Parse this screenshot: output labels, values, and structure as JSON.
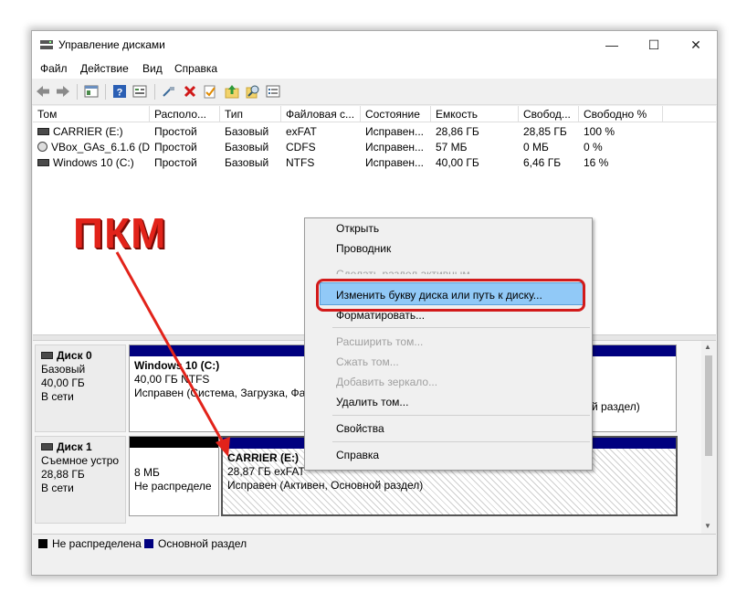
{
  "window": {
    "title": "Управление дисками",
    "controls": {
      "minimize": "—",
      "maximize": "☐",
      "close": "✕"
    }
  },
  "menu": [
    "Файл",
    "Действие",
    "Вид",
    "Справка"
  ],
  "toolbar_icons": [
    "back-arrow-icon",
    "forward-arrow-icon",
    "properties-icon",
    "help-icon",
    "view-icon",
    "connect-icon",
    "delete-icon",
    "check-icon",
    "folder-up-icon",
    "search-icon",
    "settings-icon"
  ],
  "volumes": {
    "columns": [
      "Том",
      "Располо...",
      "Тип",
      "Файловая с...",
      "Состояние",
      "Емкость",
      "Свобод...",
      "Свободно %"
    ],
    "rows": [
      {
        "name": "CARRIER (E:)",
        "layout": "Простой",
        "type": "Базовый",
        "fs": "exFAT",
        "status": "Исправен...",
        "capacity": "28,86 ГБ",
        "free": "28,85 ГБ",
        "free_pct": "100 %",
        "icon": "drive-icon"
      },
      {
        "name": "VBox_GAs_6.1.6 (D:)",
        "layout": "Простой",
        "type": "Базовый",
        "fs": "CDFS",
        "status": "Исправен...",
        "capacity": "57 МБ",
        "free": "0 МБ",
        "free_pct": "0 %",
        "icon": "cd-icon"
      },
      {
        "name": "Windows 10 (C:)",
        "layout": "Простой",
        "type": "Базовый",
        "fs": "NTFS",
        "status": "Исправен...",
        "capacity": "40,00 ГБ",
        "free": "6,46 ГБ",
        "free_pct": "16 %",
        "icon": "drive-icon"
      }
    ]
  },
  "disks": [
    {
      "name": "Диск 0",
      "kind": "Базовый",
      "size": "40,00 ГБ",
      "state": "В сети",
      "partitions": [
        {
          "title": "Windows 10  (C:)",
          "line1": "40,00 ГБ NTFS",
          "line2": "Исправен (Система, Загрузка, Фа",
          "tail": "й раздел)"
        }
      ]
    },
    {
      "name": "Диск 1",
      "kind": "Съемное устро",
      "size": "28,88 ГБ",
      "state": "В сети",
      "partitions": [
        {
          "title": "",
          "line1": "8 МБ",
          "line2": "Не распределе"
        },
        {
          "title": "CARRIER  (E:)",
          "line1": "28,87 ГБ exFAT",
          "line2": "Исправен (Активен, Основной раздел)"
        }
      ]
    }
  ],
  "legend": [
    {
      "label": "Не распределена",
      "color": "#000000"
    },
    {
      "label": "Основной раздел",
      "color": "#00007f"
    }
  ],
  "context_menu": {
    "items": [
      {
        "label": "Открыть",
        "enabled": true
      },
      {
        "label": "Проводник",
        "enabled": true
      },
      {
        "label": "Сделать раздел активным",
        "enabled": false
      },
      {
        "label": "Изменить букву диска или путь к диску...",
        "enabled": true,
        "highlighted": true
      },
      {
        "label": "Форматировать...",
        "enabled": true
      },
      {
        "label": "Расширить том...",
        "enabled": false
      },
      {
        "label": "Сжать том...",
        "enabled": false
      },
      {
        "label": "Добавить зеркало...",
        "enabled": false
      },
      {
        "label": "Удалить том...",
        "enabled": true
      },
      {
        "label": "Свойства",
        "enabled": true
      },
      {
        "label": "Справка",
        "enabled": true
      }
    ]
  },
  "annotation": {
    "text": "ПКМ",
    "color": "#e2231a"
  },
  "colors": {
    "primary_partition": "#00007f",
    "unallocated": "#000000",
    "highlight": "#91c9f7",
    "annotation_red": "#d21a1a"
  }
}
